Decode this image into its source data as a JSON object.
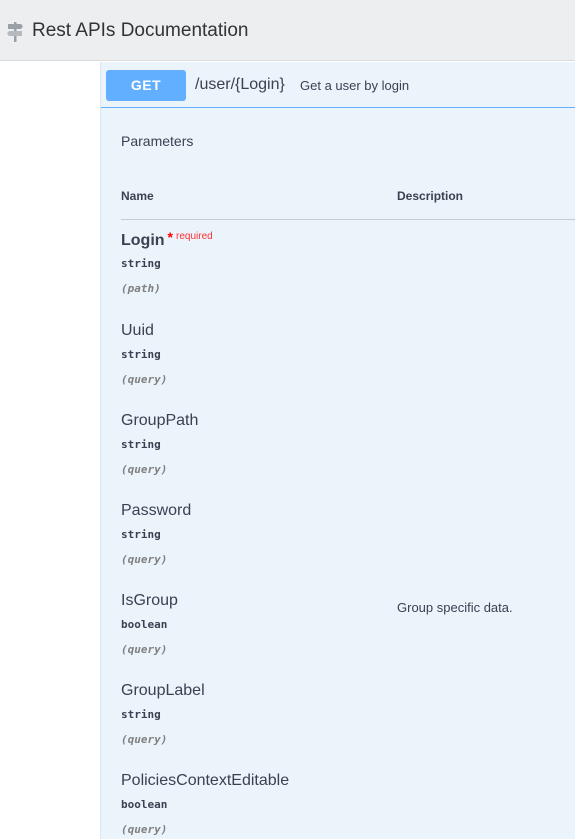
{
  "header": {
    "logo_icon": "signpost-icon",
    "title": "Rest APIs Documentation"
  },
  "operation": {
    "method": "GET",
    "path": "/user/{Login}",
    "summary": "Get a user by login",
    "method_color": "#61affe"
  },
  "parameters": {
    "section_title": "Parameters",
    "col_name": "Name",
    "col_description": "Description",
    "items": [
      {
        "name": "Login",
        "required_mark": "*",
        "required_label": "required",
        "type": "string",
        "in": "(path)",
        "description": ""
      },
      {
        "name": "Uuid",
        "type": "string",
        "in": "(query)",
        "description": ""
      },
      {
        "name": "GroupPath",
        "type": "string",
        "in": "(query)",
        "description": ""
      },
      {
        "name": "Password",
        "type": "string",
        "in": "(query)",
        "description": ""
      },
      {
        "name": "IsGroup",
        "type": "boolean",
        "in": "(query)",
        "description": "Group specific data."
      },
      {
        "name": "GroupLabel",
        "type": "string",
        "in": "(query)",
        "description": ""
      },
      {
        "name": "PoliciesContextEditable",
        "type": "boolean",
        "in": "(query)",
        "description": ""
      }
    ]
  }
}
